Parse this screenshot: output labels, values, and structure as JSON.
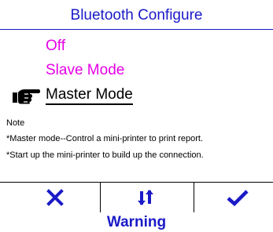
{
  "colors": {
    "accent": "#1a1ac8",
    "highlight": "#e600e6",
    "text": "#000000",
    "background": "#ffffff"
  },
  "header": {
    "title": "Bluetooth Configure"
  },
  "menu": {
    "items": [
      {
        "label": "Off",
        "selected": false
      },
      {
        "label": "Slave Mode",
        "selected": false
      },
      {
        "label": "Master Mode",
        "selected": true
      }
    ],
    "pointer_icon": "pointing-hand-icon"
  },
  "note": {
    "heading": "Note",
    "lines": [
      "*Master mode--Control a mini-printer to print report.",
      "*Start up the mini-printer to build up the connection."
    ]
  },
  "softkeys": {
    "cancel_icon": "cross-icon",
    "switch_icon": "up-down-arrows-icon",
    "confirm_icon": "checkmark-icon"
  },
  "footer": {
    "warning": "Warning"
  }
}
